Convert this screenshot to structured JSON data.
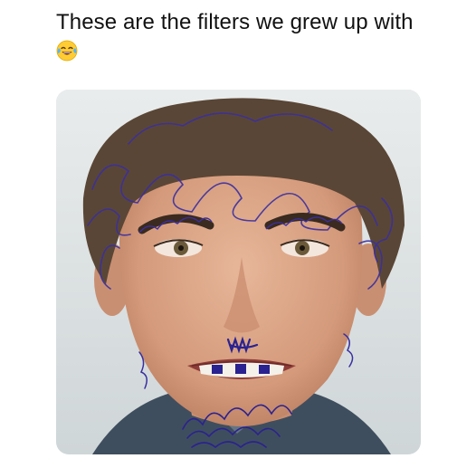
{
  "post": {
    "caption": "These are the filters we grew up with",
    "reaction_icon": "face-with-tears-of-joy-icon"
  },
  "image": {
    "subject_icon": "doodled-portrait-photo",
    "colors": {
      "background": "#dfe3e4",
      "skin": "#d9a589",
      "hair": "#5a4636",
      "ink": "#3a2fa0",
      "shirt": "#3f4e5e"
    }
  }
}
